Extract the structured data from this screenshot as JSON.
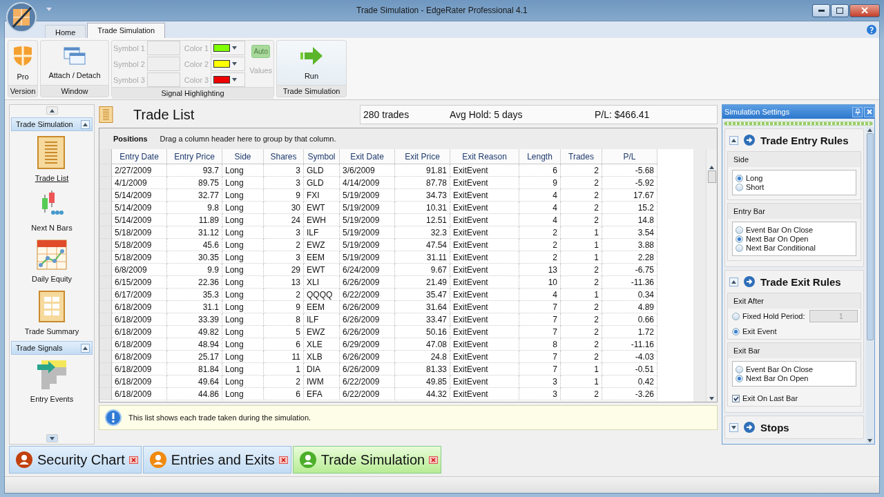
{
  "window": {
    "title": "Trade Simulation - EdgeRater Professional 4.1"
  },
  "ribbon": {
    "tabs": [
      {
        "label": "Home",
        "selected": false
      },
      {
        "label": "Trade Simulation",
        "selected": true
      }
    ],
    "version": {
      "button": "Pro",
      "caption": "Version"
    },
    "window_group": {
      "button": "Attach / Detach",
      "caption": "Window"
    },
    "signal": {
      "caption": "Signal Highlighting",
      "symbols": [
        "Symbol 1",
        "Symbol 2",
        "Symbol 3"
      ],
      "colors": [
        {
          "label": "Color 1",
          "color": "#80ff00"
        },
        {
          "label": "Color 2",
          "color": "#ffff00"
        },
        {
          "label": "Color 3",
          "color": "#ee0000"
        }
      ],
      "auto": {
        "label": "Auto",
        "disabled": true
      },
      "values": "Values"
    },
    "run": {
      "button": "Run",
      "caption": "Trade Simulation"
    }
  },
  "sidebar": {
    "sections": [
      {
        "title": "Trade Simulation",
        "expanded": true,
        "items": [
          {
            "label": "Trade List",
            "selected": true
          },
          {
            "label": "Next N Bars",
            "selected": false
          },
          {
            "label": "Daily Equity",
            "selected": false
          },
          {
            "label": "Trade Summary",
            "selected": false
          }
        ]
      },
      {
        "title": "Trade Signals",
        "expanded": true,
        "items": [
          {
            "label": "Entry Events",
            "selected": false
          }
        ]
      }
    ]
  },
  "header": {
    "title": "Trade List",
    "stats": [
      "280 trades",
      "Avg Hold: 5 days",
      "P/L: $466.41"
    ]
  },
  "grid": {
    "group_label": "Positions",
    "group_hint": "Drag a column header here to group by that column.",
    "columns": [
      {
        "label": "Entry Date",
        "kind": "text"
      },
      {
        "label": "Entry Price",
        "kind": "number"
      },
      {
        "label": "Side",
        "kind": "text"
      },
      {
        "label": "Shares",
        "kind": "number"
      },
      {
        "label": "Symbol",
        "kind": "text"
      },
      {
        "label": "Exit Date",
        "kind": "text"
      },
      {
        "label": "Exit Price",
        "kind": "number"
      },
      {
        "label": "Exit Reason",
        "kind": "text"
      },
      {
        "label": "Length",
        "kind": "number"
      },
      {
        "label": "Trades",
        "kind": "number"
      },
      {
        "label": "P/L",
        "kind": "number"
      }
    ],
    "rows": [
      [
        "2/27/2009",
        "93.7",
        "Long",
        "3",
        "GLD",
        "3/6/2009",
        "91.81",
        "ExitEvent",
        "6",
        "2",
        "-5.68"
      ],
      [
        "4/1/2009",
        "89.75",
        "Long",
        "3",
        "GLD",
        "4/14/2009",
        "87.78",
        "ExitEvent",
        "9",
        "2",
        "-5.92"
      ],
      [
        "5/14/2009",
        "32.77",
        "Long",
        "9",
        "FXI",
        "5/19/2009",
        "34.73",
        "ExitEvent",
        "4",
        "2",
        "17.67"
      ],
      [
        "5/14/2009",
        "9.8",
        "Long",
        "30",
        "EWT",
        "5/19/2009",
        "10.31",
        "ExitEvent",
        "4",
        "2",
        "15.2"
      ],
      [
        "5/14/2009",
        "11.89",
        "Long",
        "24",
        "EWH",
        "5/19/2009",
        "12.51",
        "ExitEvent",
        "4",
        "2",
        "14.8"
      ],
      [
        "5/18/2009",
        "31.12",
        "Long",
        "3",
        "ILF",
        "5/19/2009",
        "32.3",
        "ExitEvent",
        "2",
        "1",
        "3.54"
      ],
      [
        "5/18/2009",
        "45.6",
        "Long",
        "2",
        "EWZ",
        "5/19/2009",
        "47.54",
        "ExitEvent",
        "2",
        "1",
        "3.88"
      ],
      [
        "5/18/2009",
        "30.35",
        "Long",
        "3",
        "EEM",
        "5/19/2009",
        "31.11",
        "ExitEvent",
        "2",
        "1",
        "2.28"
      ],
      [
        "6/8/2009",
        "9.9",
        "Long",
        "29",
        "EWT",
        "6/24/2009",
        "9.67",
        "ExitEvent",
        "13",
        "2",
        "-6.75"
      ],
      [
        "6/15/2009",
        "22.36",
        "Long",
        "13",
        "XLI",
        "6/26/2009",
        "21.49",
        "ExitEvent",
        "10",
        "2",
        "-11.36"
      ],
      [
        "6/17/2009",
        "35.3",
        "Long",
        "2",
        "QQQQ",
        "6/22/2009",
        "35.47",
        "ExitEvent",
        "4",
        "1",
        "0.34"
      ],
      [
        "6/18/2009",
        "31.1",
        "Long",
        "9",
        "EEM",
        "6/26/2009",
        "31.64",
        "ExitEvent",
        "7",
        "2",
        "4.89"
      ],
      [
        "6/18/2009",
        "33.39",
        "Long",
        "8",
        "ILF",
        "6/26/2009",
        "33.47",
        "ExitEvent",
        "7",
        "2",
        "0.66"
      ],
      [
        "6/18/2009",
        "49.82",
        "Long",
        "5",
        "EWZ",
        "6/26/2009",
        "50.16",
        "ExitEvent",
        "7",
        "2",
        "1.72"
      ],
      [
        "6/18/2009",
        "48.94",
        "Long",
        "6",
        "XLE",
        "6/29/2009",
        "47.08",
        "ExitEvent",
        "8",
        "2",
        "-11.16"
      ],
      [
        "6/18/2009",
        "25.17",
        "Long",
        "11",
        "XLB",
        "6/26/2009",
        "24.8",
        "ExitEvent",
        "7",
        "2",
        "-4.03"
      ],
      [
        "6/18/2009",
        "81.84",
        "Long",
        "1",
        "DIA",
        "6/26/2009",
        "81.33",
        "ExitEvent",
        "7",
        "1",
        "-0.51"
      ],
      [
        "6/18/2009",
        "49.64",
        "Long",
        "2",
        "IWM",
        "6/22/2009",
        "49.85",
        "ExitEvent",
        "3",
        "1",
        "0.42"
      ],
      [
        "6/18/2009",
        "44.86",
        "Long",
        "6",
        "EFA",
        "6/22/2009",
        "44.32",
        "ExitEvent",
        "3",
        "2",
        "-3.26"
      ]
    ]
  },
  "info": {
    "text": "This list shows each trade taken during the simulation."
  },
  "settings": {
    "title": "Simulation Settings",
    "sections": [
      {
        "title": "Trade Entry Rules",
        "expanded": true,
        "groups": [
          {
            "title": "Side",
            "items": [
              {
                "kind": "radio",
                "label": "Long",
                "selected": true
              },
              {
                "kind": "radio",
                "label": "Short",
                "selected": false
              }
            ]
          },
          {
            "title": "Entry Bar",
            "items": [
              {
                "kind": "radio",
                "label": "Event Bar On Close",
                "selected": false
              },
              {
                "kind": "radio",
                "label": "Next Bar On Open",
                "selected": true
              },
              {
                "kind": "radio",
                "label": "Next Bar Conditional",
                "selected": false
              }
            ]
          }
        ]
      },
      {
        "title": "Trade Exit Rules",
        "expanded": true,
        "groups": [
          {
            "title": "Exit After",
            "items": [
              {
                "kind": "radio-spin",
                "label": "Fixed Hold Period:",
                "selected": false,
                "value": "1"
              },
              {
                "kind": "radio-loose",
                "label": "Exit Event",
                "selected": true
              }
            ]
          },
          {
            "title": "Exit Bar",
            "items": [
              {
                "kind": "radio",
                "label": "Event Bar On Close",
                "selected": false
              },
              {
                "kind": "radio",
                "label": "Next Bar On Open",
                "selected": true
              },
              {
                "kind": "checkbox",
                "label": "Exit On Last Bar",
                "checked": true
              }
            ]
          }
        ]
      },
      {
        "title": "Stops",
        "expanded": false
      }
    ]
  },
  "documents": [
    {
      "label": "Security Chart",
      "selected": false,
      "color": "#c2410c"
    },
    {
      "label": "Entries and Exits",
      "selected": false,
      "color": "#f08a10"
    },
    {
      "label": "Trade Simulation",
      "selected": true,
      "color": "#4caf2a"
    }
  ]
}
